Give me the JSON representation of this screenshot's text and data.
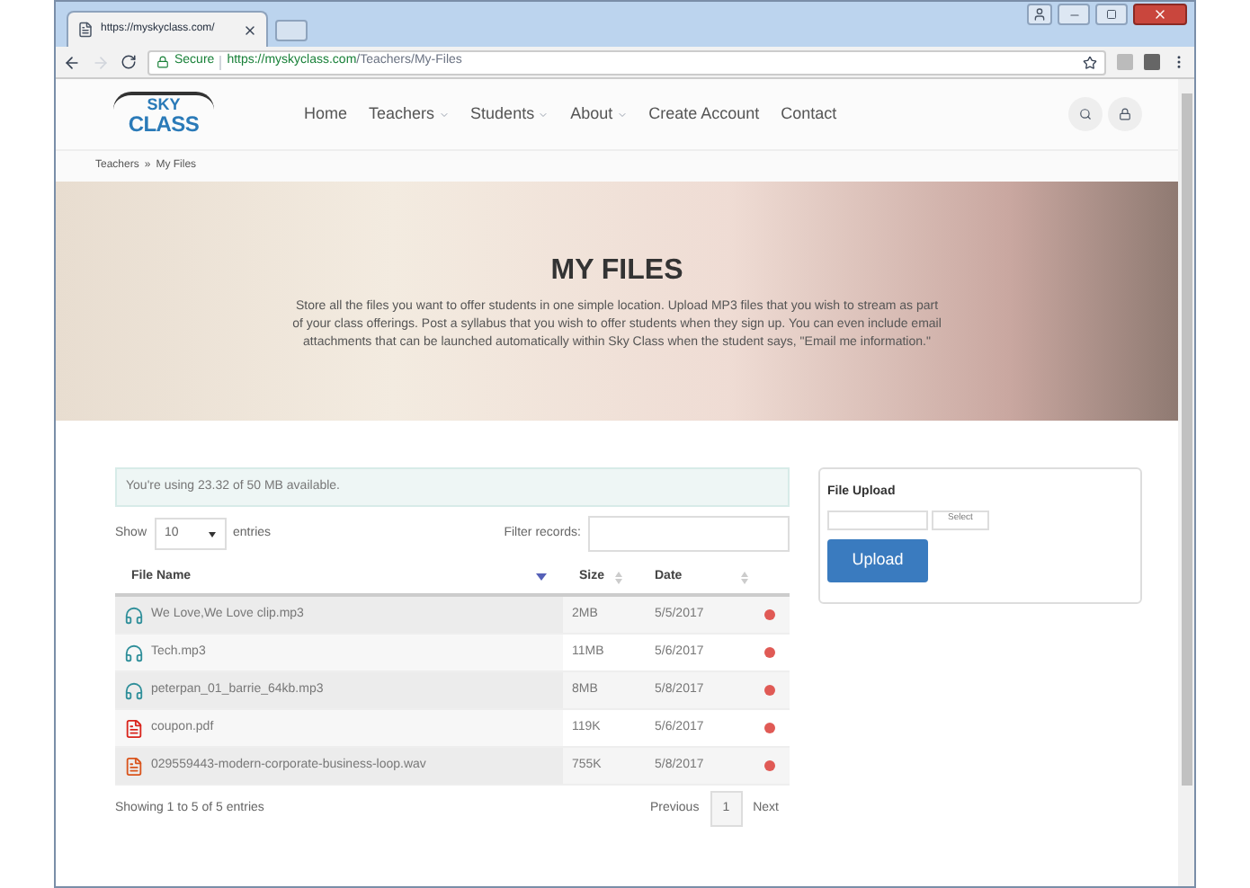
{
  "browser": {
    "tab_title": "https://myskyclass.com/",
    "secure_label": "Secure",
    "url_domain": "https://myskyclass.com",
    "url_path": "/Teachers/My-Files"
  },
  "logo": {
    "line_1": "SKY",
    "line_2": "CLASS"
  },
  "nav": [
    {
      "label": "Home",
      "dropdown": false
    },
    {
      "label": "Teachers",
      "dropdown": true
    },
    {
      "label": "Students",
      "dropdown": true
    },
    {
      "label": "About",
      "dropdown": true
    },
    {
      "label": "Create Account",
      "dropdown": false
    },
    {
      "label": "Contact",
      "dropdown": false
    }
  ],
  "breadcrumb": {
    "items": [
      "Teachers",
      "My Files"
    ],
    "separator": "»"
  },
  "hero": {
    "title": "MY FILES",
    "description": "Store all the files you want to offer students in one simple location. Upload MP3 files that you wish to stream as part of your class offerings. Post a syllabus that you wish to offer students when they sign up. You can even include email attachments that can be launched automatically within Sky Class when the student says, \"Email me information.\""
  },
  "storage_notice": "You're using 23.32 of 50 MB available.",
  "table_controls": {
    "show_label": "Show",
    "page_size": "10",
    "entries_label": "entries",
    "filter_label": "Filter records:"
  },
  "columns": [
    {
      "label": "File Name",
      "sorted": true
    },
    {
      "label": "Size",
      "sorted": false
    },
    {
      "label": "Date",
      "sorted": false
    }
  ],
  "rows": [
    {
      "kind": "audio",
      "name": "We Love,We Love clip.mp3",
      "size": "2MB",
      "date": "5/5/2017"
    },
    {
      "kind": "audio",
      "name": "Tech.mp3",
      "size": "11MB",
      "date": "5/6/2017"
    },
    {
      "kind": "audio",
      "name": "peterpan_01_barrie_64kb.mp3",
      "size": "8MB",
      "date": "5/8/2017"
    },
    {
      "kind": "pdf",
      "name": "coupon.pdf",
      "size": "119K",
      "date": "5/6/2017"
    },
    {
      "kind": "wav",
      "name": "029559443-modern-corporate-business-loop.wav",
      "size": "755K",
      "date": "5/8/2017"
    }
  ],
  "table_info": "Showing 1 to 5 of 5 entries",
  "pagination": {
    "previous": "Previous",
    "pages": [
      {
        "label": "1",
        "selected": true
      }
    ],
    "next": "Next"
  },
  "upload": {
    "title": "File Upload",
    "select_label": "Select",
    "button": "Upload"
  }
}
